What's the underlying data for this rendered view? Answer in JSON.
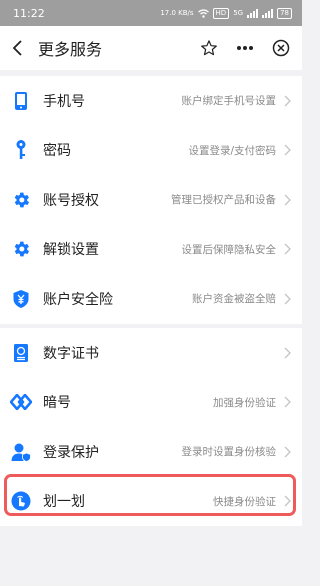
{
  "status_bar": {
    "time": "11:22",
    "network_speed": "17.0 KB/s",
    "hd_badge": "HD",
    "signal_label": "5G",
    "battery": "78"
  },
  "nav": {
    "title": "更多服务"
  },
  "colors": {
    "accent": "#1677ff",
    "highlight": "#ef5b5b"
  },
  "group1": {
    "items": [
      {
        "label": "手机号",
        "desc": "账户绑定手机号设置",
        "icon": "phone-icon"
      },
      {
        "label": "密码",
        "desc": "设置登录/支付密码",
        "icon": "key-icon"
      },
      {
        "label": "账号授权",
        "desc": "管理已授权产品和设备",
        "icon": "gear-icon"
      },
      {
        "label": "解锁设置",
        "desc": "设置后保障隐私安全",
        "icon": "gear-icon"
      },
      {
        "label": "账户安全险",
        "desc": "账户资金被盗全赔",
        "icon": "yen-shield-icon"
      }
    ]
  },
  "group2": {
    "items": [
      {
        "label": "数字证书",
        "desc": "",
        "icon": "certificate-icon"
      },
      {
        "label": "暗号",
        "desc": "加强身份验证",
        "icon": "diamond-link-icon"
      },
      {
        "label": "登录保护",
        "desc": "登录时设置身份核验",
        "icon": "user-shield-icon"
      },
      {
        "label": "划一划",
        "desc": "快捷身份验证",
        "icon": "swipe-hand-icon"
      }
    ]
  }
}
